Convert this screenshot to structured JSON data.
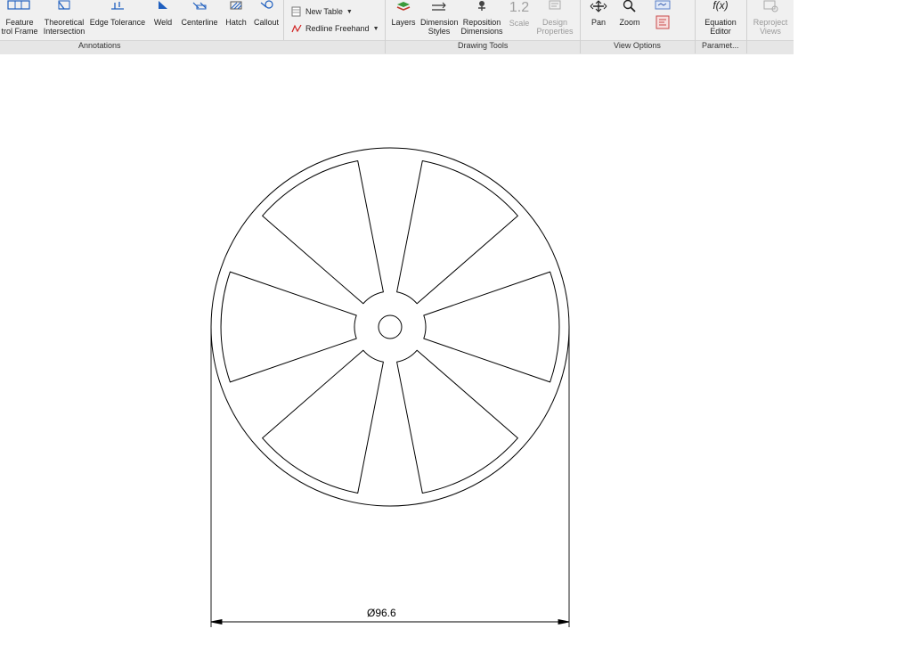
{
  "ribbon": {
    "groups": [
      {
        "label": "Annotations"
      },
      {
        "label": "Drawing Tools"
      },
      {
        "label": "View Options"
      },
      {
        "label": "Paramet..."
      }
    ],
    "annotations": {
      "feature_control_frame": "Feature\ntrol Frame",
      "theoretical_intersection": "Theoretical\nIntersection",
      "edge_tolerance": "Edge Tolerance",
      "weld": "Weld",
      "centerline": "Centerline",
      "hatch": "Hatch",
      "callout": "Callout",
      "new_table": "New Table",
      "redline_freehand": "Redline Freehand"
    },
    "drawing_tools": {
      "layers": "Layers",
      "dimension_styles": "Dimension\nStyles",
      "reposition_dimensions": "Reposition\nDimensions",
      "scale": "Scale",
      "scale_glyph": "1.2",
      "design_properties": "Design\nProperties"
    },
    "view_options": {
      "pan": "Pan",
      "zoom": "Zoom"
    },
    "parameters": {
      "equation_editor": "Equation\nEditor",
      "equation_glyph": "f(x)"
    },
    "reproject_views": "Reproject\nViews"
  },
  "drawing": {
    "diameter_dimension": "Ø96.6"
  },
  "colors": {
    "ribbon_bg": "#f0f0f0",
    "icon_blue": "#1f5fbf",
    "redline_red": "#d02020",
    "drawing_line": "#000000"
  }
}
